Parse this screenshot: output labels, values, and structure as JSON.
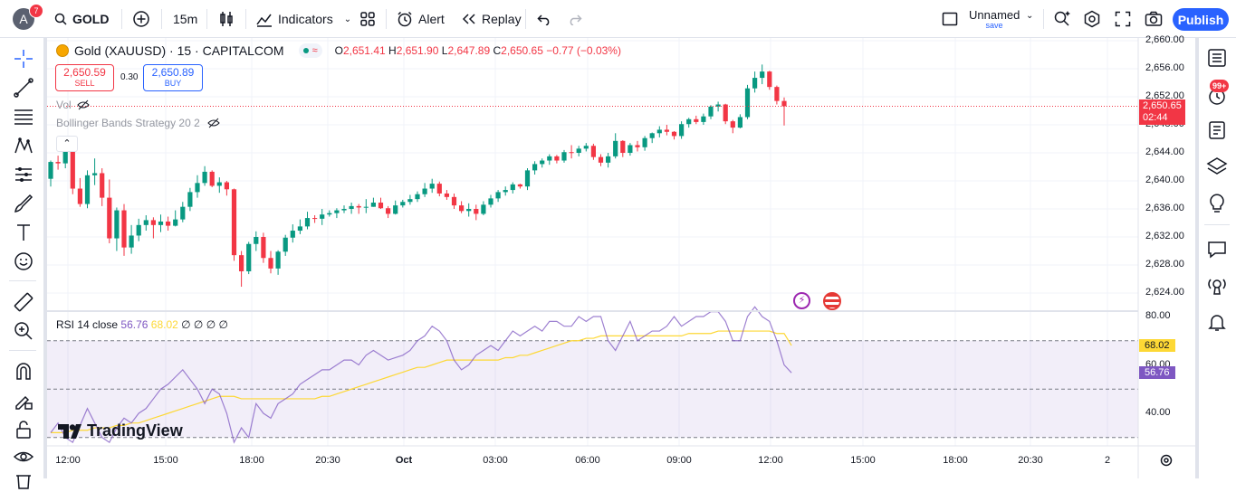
{
  "topbar": {
    "avatar_letter": "A",
    "avatar_badge": "7",
    "symbol": "GOLD",
    "interval": "15m",
    "indicators_label": "Indicators",
    "alert_label": "Alert",
    "replay_label": "Replay",
    "layout_name": "Unnamed",
    "layout_status": "save",
    "publish_label": "Publish"
  },
  "legend": {
    "title": "Gold (XAUUSD) · 15 · CAPITALCOM",
    "ohlc": {
      "o_label": "O",
      "o": "2,651.41",
      "h_label": "H",
      "h": "2,651.90",
      "l_label": "L",
      "l": "2,647.89",
      "c_label": "C",
      "c": "2,650.65",
      "change": "−0.77 (−0.03%)"
    },
    "sell_price": "2,650.59",
    "sell_label": "SELL",
    "spread": "0.30",
    "buy_price": "2,650.89",
    "buy_label": "BUY",
    "vol_label": "Vol",
    "strategy_label": "Bollinger Bands Strategy 20 2",
    "rsi_label": "RSI 14 close",
    "rsi_value": "56.76",
    "rsi_ma_value": "68.02",
    "rsi_extra": "∅ ∅ ∅ ∅"
  },
  "price_tag": {
    "price": "2,650.65",
    "countdown": "02:44"
  },
  "rsi_tags": {
    "ma": "68.02",
    "rsi": "56.76"
  },
  "watermark": "TradingView",
  "notifications_badge": "99+",
  "colors": {
    "up": "#089981",
    "down": "#f23645",
    "accent": "#2962ff",
    "rsi": "#7e57c2",
    "rsi_ma": "#fdd835"
  },
  "icons": {
    "left": [
      "crosshair-icon",
      "trend-line-icon",
      "fib-icon",
      "pattern-icon",
      "forecast-icon",
      "brush-icon",
      "text-icon",
      "emoji-icon",
      "ruler-icon",
      "zoom-in-icon",
      "magnet-icon",
      "lock-draw-icon",
      "lock-icon",
      "eye-icon",
      "trash-icon"
    ],
    "right": [
      "watchlist-icon",
      "alerts-icon",
      "notes-icon",
      "layers-icon",
      "ideas-icon",
      "chat-icon",
      "streams-icon",
      "notifications-icon"
    ]
  },
  "chart_data": {
    "type": "candlestick",
    "price_axis": [
      "2,660.00",
      "2,656.00",
      "2,652.00",
      "2,648.00",
      "2,644.00",
      "2,640.00",
      "2,636.00",
      "2,632.00",
      "2,628.00",
      "2,624.00"
    ],
    "price_values": [
      2660,
      2656,
      2652,
      2648,
      2644,
      2640,
      2636,
      2632,
      2628,
      2624
    ],
    "rsi_axis": [
      "80.00",
      "60.00",
      "40.00"
    ],
    "rsi_values_axis": [
      80,
      60,
      40
    ],
    "rsi_bands": [
      70,
      50,
      30
    ],
    "time_axis": [
      "12:00",
      "15:00",
      "18:00",
      "20:30",
      "Oct",
      "03:00",
      "06:00",
      "09:00",
      "12:00",
      "15:00",
      "18:00",
      "20:30",
      "2"
    ],
    "candles": [
      [
        2640.3,
        2642.9,
        2639.2,
        2642.7
      ],
      [
        2642.7,
        2643.6,
        2641.6,
        2642.5
      ],
      [
        2642.5,
        2644.8,
        2641.8,
        2644.3
      ],
      [
        2644.3,
        2644.5,
        2638.1,
        2638.9
      ],
      [
        2638.9,
        2640.4,
        2636.3,
        2636.7
      ],
      [
        2636.7,
        2641.5,
        2636.1,
        2640.8
      ],
      [
        2640.8,
        2643.2,
        2639.4,
        2641.1
      ],
      [
        2641.1,
        2641.8,
        2636.4,
        2637.6
      ],
      [
        2637.6,
        2640.2,
        2631.1,
        2631.8
      ],
      [
        2631.8,
        2636.2,
        2630.0,
        2635.8
      ],
      [
        2635.8,
        2636.7,
        2629.3,
        2630.5
      ],
      [
        2630.5,
        2633.7,
        2629.6,
        2632.2
      ],
      [
        2632.2,
        2634.6,
        2631.4,
        2633.7
      ],
      [
        2633.7,
        2635.1,
        2632.9,
        2634.4
      ],
      [
        2634.4,
        2634.8,
        2631.8,
        2633.7
      ],
      [
        2633.7,
        2635.2,
        2632.7,
        2634.2
      ],
      [
        2634.2,
        2634.9,
        2632.9,
        2633.6
      ],
      [
        2633.6,
        2635.8,
        2633.5,
        2634.5
      ],
      [
        2634.5,
        2637.0,
        2634.1,
        2636.3
      ],
      [
        2636.3,
        2639.0,
        2635.7,
        2638.4
      ],
      [
        2638.4,
        2640.8,
        2637.6,
        2639.7
      ],
      [
        2639.7,
        2642.1,
        2639.3,
        2641.3
      ],
      [
        2641.3,
        2641.5,
        2639.1,
        2639.3
      ],
      [
        2639.3,
        2640.5,
        2638.3,
        2639.8
      ],
      [
        2639.8,
        2640.0,
        2637.9,
        2638.8
      ],
      [
        2638.8,
        2638.9,
        2628.6,
        2629.4
      ],
      [
        2629.4,
        2630.0,
        2624.9,
        2627.1
      ],
      [
        2627.1,
        2631.3,
        2626.7,
        2631.0
      ],
      [
        2631.0,
        2632.8,
        2630.0,
        2632.0
      ],
      [
        2632.0,
        2632.6,
        2628.3,
        2629.0
      ],
      [
        2629.0,
        2630.0,
        2626.8,
        2627.5
      ],
      [
        2627.5,
        2630.1,
        2626.6,
        2629.9
      ],
      [
        2629.9,
        2632.3,
        2629.3,
        2631.9
      ],
      [
        2631.9,
        2633.8,
        2631.2,
        2632.9
      ],
      [
        2632.9,
        2634.5,
        2632.4,
        2633.5
      ],
      [
        2633.5,
        2635.6,
        2633.1,
        2634.7
      ],
      [
        2634.7,
        2635.1,
        2634.0,
        2634.6
      ],
      [
        2634.6,
        2636.0,
        2633.7,
        2635.2
      ],
      [
        2635.2,
        2635.8,
        2634.9,
        2635.4
      ],
      [
        2635.4,
        2636.1,
        2634.7,
        2635.8
      ],
      [
        2635.8,
        2636.5,
        2635.4,
        2636.0
      ],
      [
        2636.0,
        2636.9,
        2635.3,
        2636.4
      ],
      [
        2636.4,
        2636.7,
        2635.3,
        2636.2
      ],
      [
        2636.2,
        2637.4,
        2635.4,
        2636.3
      ],
      [
        2636.3,
        2637.6,
        2636.3,
        2636.9
      ],
      [
        2636.9,
        2637.6,
        2636.0,
        2636.1
      ],
      [
        2636.1,
        2636.4,
        2634.7,
        2635.3
      ],
      [
        2635.3,
        2637.2,
        2635.2,
        2636.5
      ],
      [
        2636.5,
        2637.3,
        2636.2,
        2637.0
      ],
      [
        2637.0,
        2638.0,
        2636.6,
        2637.4
      ],
      [
        2637.4,
        2638.5,
        2637.0,
        2638.1
      ],
      [
        2638.1,
        2639.7,
        2637.7,
        2638.9
      ],
      [
        2638.9,
        2640.3,
        2638.3,
        2639.6
      ],
      [
        2639.6,
        2639.9,
        2637.8,
        2638.2
      ],
      [
        2638.2,
        2638.7,
        2637.3,
        2637.7
      ],
      [
        2637.7,
        2638.2,
        2636.0,
        2636.5
      ],
      [
        2636.5,
        2637.1,
        2635.4,
        2635.7
      ],
      [
        2635.7,
        2636.8,
        2634.9,
        2636.0
      ],
      [
        2636.0,
        2636.6,
        2634.4,
        2635.3
      ],
      [
        2635.3,
        2637.1,
        2635.1,
        2636.6
      ],
      [
        2636.6,
        2638.0,
        2636.2,
        2637.5
      ],
      [
        2637.5,
        2638.7,
        2637.0,
        2638.4
      ],
      [
        2638.4,
        2639.2,
        2637.9,
        2638.7
      ],
      [
        2638.7,
        2639.8,
        2638.2,
        2639.5
      ],
      [
        2639.5,
        2639.6,
        2638.9,
        2639.2
      ],
      [
        2639.2,
        2641.8,
        2638.7,
        2641.5
      ],
      [
        2641.5,
        2642.8,
        2640.9,
        2642.4
      ],
      [
        2642.4,
        2643.2,
        2641.9,
        2642.9
      ],
      [
        2642.9,
        2643.8,
        2642.3,
        2643.5
      ],
      [
        2643.5,
        2643.7,
        2642.5,
        2642.9
      ],
      [
        2642.9,
        2644.4,
        2642.6,
        2644.1
      ],
      [
        2644.1,
        2645.1,
        2643.2,
        2644.0
      ],
      [
        2644.0,
        2645.0,
        2643.5,
        2644.6
      ],
      [
        2644.6,
        2645.4,
        2644.2,
        2645.0
      ],
      [
        2645.0,
        2645.3,
        2643.0,
        2643.4
      ],
      [
        2643.4,
        2643.8,
        2642.1,
        2642.6
      ],
      [
        2642.6,
        2644.0,
        2641.9,
        2643.5
      ],
      [
        2643.5,
        2646.8,
        2643.2,
        2645.7
      ],
      [
        2645.7,
        2645.8,
        2643.4,
        2644.0
      ],
      [
        2644.0,
        2645.4,
        2643.6,
        2645.1
      ],
      [
        2645.1,
        2645.7,
        2644.2,
        2644.8
      ],
      [
        2644.8,
        2646.4,
        2644.3,
        2646.1
      ],
      [
        2646.1,
        2646.9,
        2645.4,
        2646.8
      ],
      [
        2646.8,
        2647.8,
        2646.2,
        2647.3
      ],
      [
        2647.3,
        2648.0,
        2646.5,
        2647.0
      ],
      [
        2647.0,
        2647.1,
        2645.9,
        2646.4
      ],
      [
        2646.4,
        2648.5,
        2646.0,
        2648.1
      ],
      [
        2648.1,
        2649.0,
        2647.6,
        2648.8
      ],
      [
        2648.8,
        2649.3,
        2648.1,
        2648.4
      ],
      [
        2648.4,
        2649.6,
        2648.0,
        2649.2
      ],
      [
        2649.2,
        2650.8,
        2648.8,
        2650.6
      ],
      [
        2650.6,
        2651.3,
        2649.9,
        2650.9
      ],
      [
        2650.9,
        2651.0,
        2648.1,
        2648.5
      ],
      [
        2648.5,
        2648.7,
        2646.8,
        2647.6
      ],
      [
        2647.6,
        2649.5,
        2647.5,
        2649.1
      ],
      [
        2649.1,
        2653.7,
        2648.8,
        2653.2
      ],
      [
        2653.2,
        2655.6,
        2652.6,
        2654.7
      ],
      [
        2654.7,
        2656.6,
        2653.8,
        2655.6
      ],
      [
        2655.6,
        2655.7,
        2653.0,
        2653.4
      ],
      [
        2653.4,
        2653.6,
        2650.9,
        2651.4
      ],
      [
        2651.4,
        2651.9,
        2647.9,
        2650.65
      ]
    ],
    "rsi": [
      32,
      36,
      30,
      28,
      35,
      42,
      36,
      30,
      28,
      34,
      38,
      36,
      40,
      42,
      46,
      50,
      52,
      55,
      58,
      54,
      50,
      44,
      50,
      48,
      40,
      28,
      34,
      30,
      44,
      40,
      38,
      44,
      46,
      48,
      52,
      54,
      56,
      58,
      58,
      60,
      62,
      62,
      60,
      64,
      66,
      64,
      62,
      63,
      64,
      66,
      70,
      72,
      76,
      74,
      70,
      62,
      58,
      60,
      64,
      66,
      68,
      66,
      70,
      74,
      72,
      74,
      76,
      74,
      78,
      78,
      76,
      76,
      80,
      78,
      80,
      80,
      70,
      66,
      72,
      78,
      70,
      72,
      74,
      74,
      76,
      80,
      76,
      78,
      80,
      80,
      82,
      82,
      78,
      70,
      70,
      80,
      84,
      80,
      78,
      70,
      60,
      56.76
    ],
    "rsi_ma": [
      32,
      32,
      32,
      33,
      33,
      33,
      34,
      34,
      34,
      35,
      35,
      36,
      36,
      37,
      38,
      39,
      40,
      41,
      42,
      43,
      44,
      45,
      46,
      47,
      47,
      47,
      46,
      46,
      46,
      46,
      46,
      46,
      46,
      46,
      46,
      46,
      46,
      47,
      47,
      48,
      49,
      50,
      51,
      52,
      53,
      54,
      55,
      56,
      57,
      58,
      59,
      59,
      60,
      61,
      62,
      62,
      62,
      62,
      62,
      62,
      62,
      62,
      63,
      63,
      64,
      64,
      65,
      66,
      67,
      68,
      69,
      70,
      70,
      71,
      71,
      72,
      72,
      72,
      72,
      72,
      72,
      72,
      72,
      72,
      72,
      72,
      72,
      73,
      73,
      73,
      73,
      74,
      74,
      74,
      74,
      74,
      74,
      74,
      74,
      73,
      73,
      68.02
    ]
  }
}
